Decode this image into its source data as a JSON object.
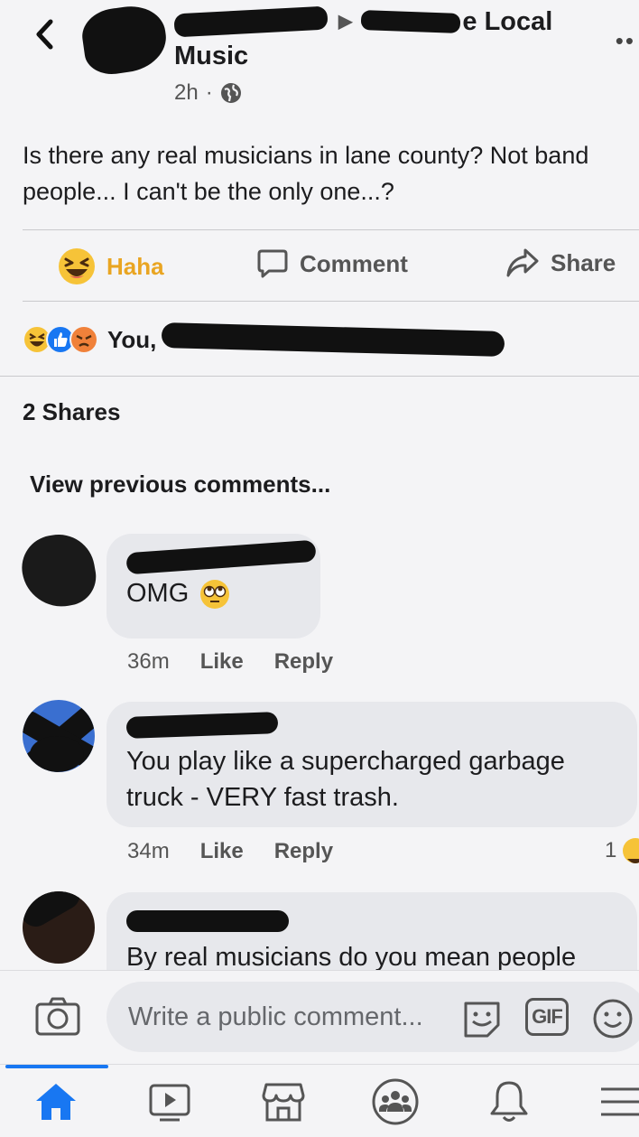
{
  "header": {
    "group_name_suffix": "e Local",
    "group_name_line2": "Music",
    "time": "2h",
    "separator": "·",
    "more": "••"
  },
  "post": {
    "text": "Is there any real musicians in lane county? Not band people... I can't be the only one...?"
  },
  "actions": {
    "haha_label": "Haha",
    "comment_label": "Comment",
    "share_label": "Share"
  },
  "reactions": {
    "names_prefix": "You,"
  },
  "shares_label": "2 Shares",
  "view_previous": "View previous comments...",
  "comments": [
    {
      "text": "OMG",
      "time": "36m",
      "like": "Like",
      "reply": "Reply"
    },
    {
      "text": "You play like a supercharged garbage truck - VERY fast trash.",
      "time": "34m",
      "like": "Like",
      "reply": "Reply",
      "reaction_count": "1"
    },
    {
      "text": "By real musicians do you mean people"
    }
  ],
  "composer": {
    "placeholder": "Write a public comment...",
    "gif_label": "GIF"
  },
  "colors": {
    "accent": "#1877f2",
    "haha": "#e9a522",
    "bubble": "#e7e8ec",
    "background": "#f4f4f6"
  },
  "icons": [
    "back-icon",
    "globe-icon",
    "haha-icon",
    "comment-icon",
    "share-icon",
    "camera-icon",
    "sticker-icon",
    "gif-icon",
    "emoji-icon",
    "home-icon",
    "video-icon",
    "marketplace-icon",
    "groups-icon",
    "bell-icon",
    "menu-icon"
  ]
}
